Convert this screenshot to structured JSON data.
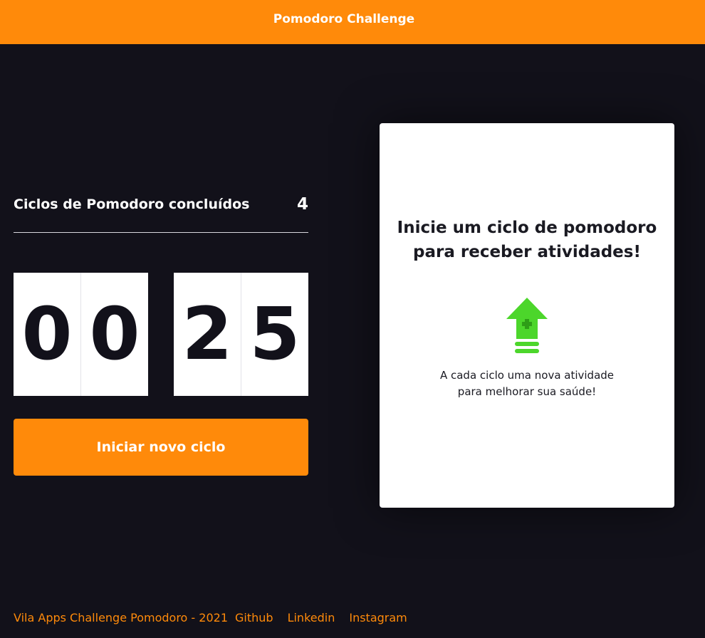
{
  "header": {
    "title": "Pomodoro Challenge"
  },
  "cycles": {
    "label": "Ciclos de Pomodoro concluídos",
    "count": "4"
  },
  "timer": {
    "minutes": [
      "0",
      "0"
    ],
    "seconds": [
      "2",
      "5"
    ]
  },
  "actions": {
    "start_label": "Iniciar novo ciclo"
  },
  "card": {
    "title_line1": "Inicie um ciclo de pomodoro",
    "title_line2": "para receber atividades!",
    "icon": "level-up-arrow-icon",
    "description": "A cada ciclo uma nova atividade para melhorar sua saúde!"
  },
  "footer": {
    "credit": "Vila Apps Challenge Pomodoro - 2021",
    "links": [
      "Github",
      "Linkedin",
      "Instagram"
    ]
  },
  "colors": {
    "accent": "#ff8a0a",
    "background": "#12111a",
    "icon_green": "#4cd62b"
  }
}
